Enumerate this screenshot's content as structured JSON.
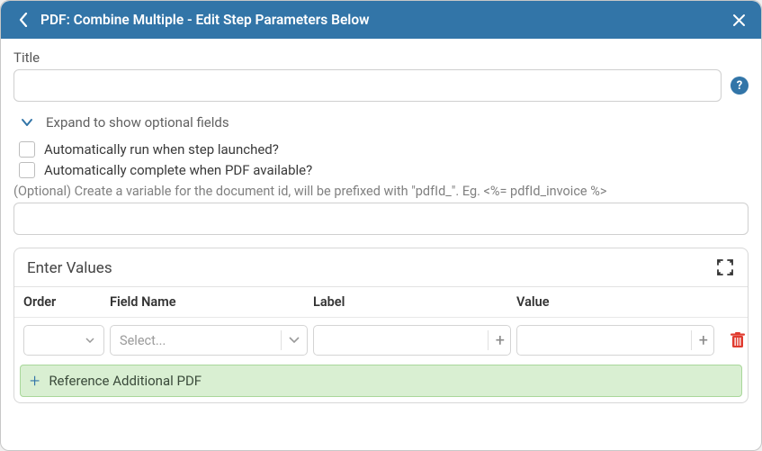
{
  "header": {
    "title": "PDF: Combine Multiple - Edit Step Parameters Below"
  },
  "form": {
    "title_label": "Title",
    "title_value": "",
    "expand_label": "Expand to show optional fields",
    "auto_run_label": "Automatically run when step launched?",
    "auto_complete_label": "Automatically complete when PDF available?",
    "variable_hint": "(Optional) Create a variable for the document id, will be prefixed with \"pdfId_\". Eg. <%= pdfId_invoice %>",
    "variable_value": ""
  },
  "panel": {
    "title": "Enter Values",
    "columns": {
      "order": "Order",
      "field_name": "Field Name",
      "label": "Label",
      "value": "Value"
    },
    "row": {
      "field_name_placeholder": "Select..."
    },
    "add_button_label": "Reference Additional PDF"
  }
}
